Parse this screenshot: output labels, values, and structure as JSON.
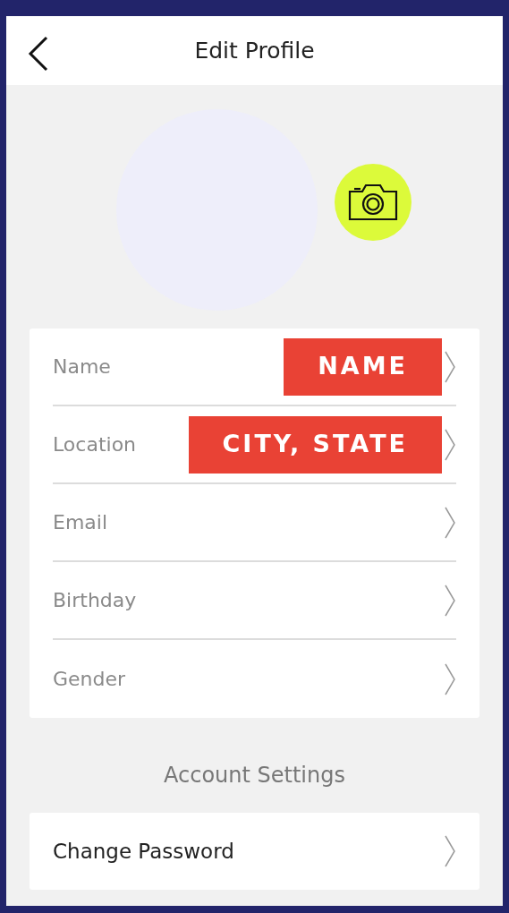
{
  "header": {
    "title": "Edit Profile"
  },
  "profile_fields": [
    {
      "label": "Name",
      "value": "NAME"
    },
    {
      "label": "Location",
      "value": "CITY, STATE"
    },
    {
      "label": "Email"
    },
    {
      "label": "Birthday"
    },
    {
      "label": "Gender"
    }
  ],
  "account_settings": {
    "heading": "Account Settings",
    "items": [
      {
        "label": "Change Password"
      }
    ]
  }
}
